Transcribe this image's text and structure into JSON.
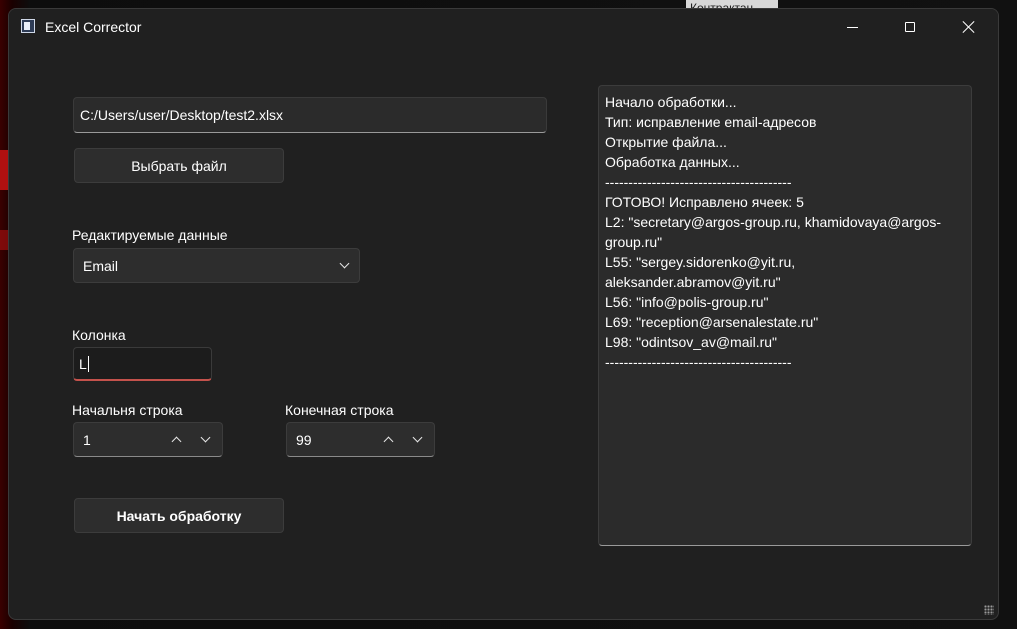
{
  "window": {
    "title": "Excel Corrector",
    "background_tab": "Контрактац"
  },
  "file": {
    "path": "C:/Users/user/Desktop/test2.xlsx",
    "choose_button": "Выбрать файл"
  },
  "data_type": {
    "label": "Редактируемые данные",
    "selected": "Email"
  },
  "column": {
    "label": "Колонка",
    "value": "L"
  },
  "start_row": {
    "label": "Начальня строка",
    "value": "1"
  },
  "end_row": {
    "label": "Конечная строка",
    "value": "99"
  },
  "start_button": "Начать обработку",
  "log": {
    "lines": [
      "Начало обработки...",
      "Тип: исправление email-адресов",
      "Открытие файла...",
      "Обработка данных...",
      "----------------------------------------",
      "ГОТОВО! Исправлено ячеек: 5",
      "L2: \"secretary@argos-group.ru, khamidovaya@argos-group.ru\"",
      "L55: \"sergey.sidorenko@yit.ru, aleksander.abramov@yit.ru\"",
      "L56: \"info@polis-group.ru\"",
      "L69: \"reception@arsenalestate.ru\"",
      "L98: \"odintsov_av@mail.ru\"",
      "----------------------------------------"
    ]
  },
  "colors": {
    "window_bg": "#202020",
    "control_bg": "#2d2d2d",
    "focus_underline": "#c4524c"
  }
}
